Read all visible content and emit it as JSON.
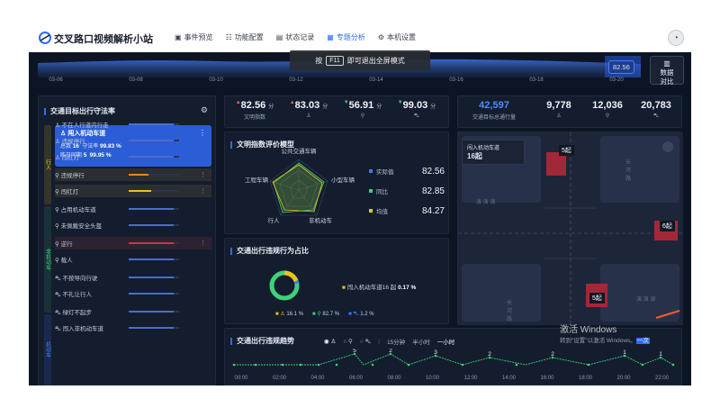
{
  "app": {
    "title": "交叉路口视频解析小站"
  },
  "nav": [
    {
      "icon": "event-icon",
      "glyph": "▣",
      "label": "事件预览",
      "active": false
    },
    {
      "icon": "config-icon",
      "glyph": "☷",
      "label": "功能配置",
      "active": false
    },
    {
      "icon": "record-icon",
      "glyph": "▤",
      "label": "状态记录",
      "active": false
    },
    {
      "icon": "analysis-icon",
      "glyph": "▦",
      "label": "专题分析",
      "active": true
    },
    {
      "icon": "settings-icon",
      "glyph": "⚙",
      "label": "本机设置",
      "active": false
    }
  ],
  "timeline": {
    "labels": [
      "03-06",
      "03-08",
      "03-10",
      "03-12",
      "03-14",
      "03-16",
      "03-18",
      "03-20"
    ],
    "selected_value": "82.56",
    "compare_button": [
      "数据",
      "对比"
    ]
  },
  "toast": {
    "prefix": "按",
    "key": "F11",
    "suffix": "即可退出全屏模式"
  },
  "left_panel": {
    "title": "交通目标出行守法率",
    "side_labels": [
      "行人",
      "非机动车",
      "机动车"
    ],
    "hero": {
      "label": "闯入机动车道",
      "total_label": "总数",
      "total": "16",
      "rate_label": "守法率",
      "rate": "99.83 %",
      "prev_label": "昨日同期",
      "prev_total": "5",
      "prev_rate": "99.95 %"
    },
    "items": [
      {
        "label": "不在人行道内行走",
        "style": "normal",
        "fill": 0.9,
        "color": "#4d6ccc"
      },
      {
        "label": "违规停行",
        "style": "normal",
        "fill": 0.9,
        "color": "#4d6ccc"
      },
      {
        "label": "闯红灯",
        "style": "normal",
        "fill": 0.9,
        "color": "#4d6ccc"
      },
      {
        "label": "违规停行",
        "style": "warn",
        "fill": 0.4,
        "color": "#e08a1e"
      },
      {
        "label": "闯红灯",
        "style": "warn",
        "fill": 0.45,
        "color": "#e8c419"
      },
      {
        "label": "占用机动车道",
        "style": "normal",
        "fill": 0.9,
        "color": "#4d6ccc"
      },
      {
        "label": "未佩戴安全头盔",
        "style": "normal",
        "fill": 0.9,
        "color": "#4d6ccc"
      },
      {
        "label": "逆行",
        "style": "red",
        "fill": 0.9,
        "color": "#c0394b"
      },
      {
        "label": "载人",
        "style": "normal",
        "fill": 0.9,
        "color": "#4d6ccc"
      },
      {
        "label": "不按导向行驶",
        "style": "normal",
        "fill": 0.9,
        "color": "#4d6ccc"
      },
      {
        "label": "不礼让行人",
        "style": "normal",
        "fill": 0.9,
        "color": "#4d6ccc"
      },
      {
        "label": "绿灯不起步",
        "style": "normal",
        "fill": 0.9,
        "color": "#4d6ccc"
      },
      {
        "label": "闯入非机动车道",
        "style": "normal",
        "fill": 0.9,
        "color": "#4d6ccc"
      }
    ]
  },
  "stats": [
    {
      "value": "82.56",
      "unit": "分",
      "arrow": "up",
      "label": "文明指数"
    },
    {
      "value": "83.03",
      "unit": "分",
      "arrow": "up",
      "label": ""
    },
    {
      "value": "56.91",
      "unit": "分",
      "arrow": "down",
      "label": ""
    },
    {
      "value": "99.03",
      "unit": "分",
      "arrow": "down",
      "label": ""
    }
  ],
  "stats2": [
    {
      "value": "42,597",
      "label": "交通目标总通行量",
      "highlight": true
    },
    {
      "value": "9,778",
      "label": "",
      "highlight": false
    },
    {
      "value": "12,036",
      "label": "",
      "highlight": false
    },
    {
      "value": "20,783",
      "label": "",
      "highlight": false
    }
  ],
  "radar": {
    "title": "文明指数评价模型",
    "axes": [
      "公共交通车辆",
      "小型车辆",
      "非机动车",
      "行人",
      "工程车辆"
    ],
    "legend": [
      {
        "label": "实际值",
        "value": "82.56",
        "color": "#3e7bff"
      },
      {
        "label": "同比",
        "value": "82.85",
        "color": "#3ed17a"
      },
      {
        "label": "均值",
        "value": "84.27",
        "color": "#e8c419"
      }
    ]
  },
  "donut": {
    "title": "交通出行违规行为占比",
    "main_label": "闯入机动车道",
    "main_value": "16 起",
    "main_pct": "0.17 %",
    "breakdown": [
      {
        "value": "16.1 %",
        "color": "#e8c419"
      },
      {
        "value": "82.7 %",
        "color": "#3ed17a"
      },
      {
        "value": "1.2 %",
        "color": "#3e7bff"
      }
    ]
  },
  "trend": {
    "title": "交通出行违规趋势",
    "ctrl_intervals": [
      "15分钟",
      "半小时",
      "一小时"
    ],
    "selected_interval": "一小时",
    "x_labels": [
      "00:00",
      "02:00",
      "04:00",
      "06:00",
      "08:00",
      "10:00",
      "12:00",
      "14:00",
      "16:00",
      "18:00",
      "20:00",
      "22:00"
    ],
    "peak_labels": [
      "5",
      "2",
      "3",
      "2",
      "2",
      "1",
      "1"
    ]
  },
  "map": {
    "markers": [
      {
        "label": "5起"
      },
      {
        "label": "6起"
      },
      {
        "label": "5起"
      }
    ],
    "popup": {
      "label": "闯入机动车道",
      "value": "16起"
    },
    "zones": [
      "演 演 演",
      "演 演 演",
      "长 河 路",
      "长 河 路"
    ]
  },
  "watermark": {
    "line1": "激活 Windows",
    "line2": "转到\"设置\"以激活 Windows。",
    "hl": "一次"
  }
}
